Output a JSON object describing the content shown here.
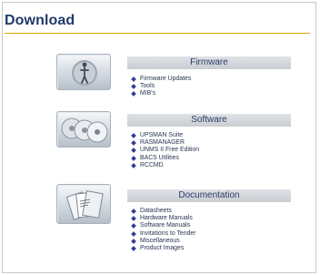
{
  "page": {
    "title": "Download"
  },
  "sections": [
    {
      "heading": "Firmware",
      "icon": "firmware-icon",
      "links": [
        "Firmware Updates",
        "Tools",
        "MIB's"
      ]
    },
    {
      "heading": "Software",
      "icon": "cd-stack-icon",
      "links": [
        "UPSMAN Suite",
        "RASMANAGER",
        "UNMS II Free Edition",
        "BACS Utilities",
        "RCCMD"
      ]
    },
    {
      "heading": "Documentation",
      "icon": "documents-icon",
      "links": [
        "Datasheets",
        "Hardware Manuals",
        "Software Manuals",
        "Invitations to Tender",
        "Miscellaneous",
        "Product Images"
      ]
    }
  ],
  "colors": {
    "title": "#1f3a6b",
    "rule": "#e3a300",
    "bullet": "#2f3e99",
    "header_bg": "#d4d8dc"
  }
}
